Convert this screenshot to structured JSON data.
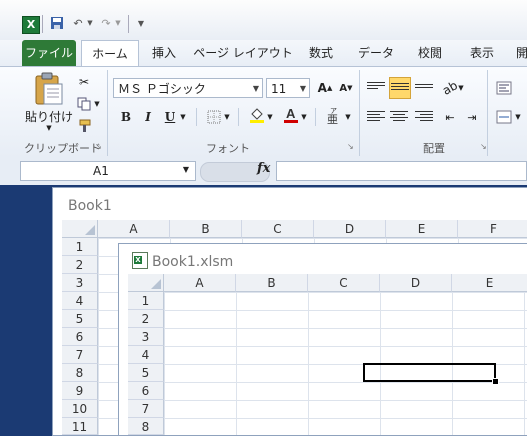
{
  "colors": {
    "file_tab": "#2e7a37",
    "frame": "#1b3a73"
  },
  "tabs": [
    "ファイル",
    "ホーム",
    "挿入",
    "ページ レイアウト",
    "数式",
    "データ",
    "校閲",
    "表示",
    "開"
  ],
  "clipboard": {
    "paste_label": "貼り付け",
    "group_label": "クリップボード"
  },
  "font": {
    "name": "ＭＳ Ｐゴシック",
    "size": "11",
    "group_label": "フォント"
  },
  "alignment": {
    "group_label": "配置"
  },
  "formula_bar": {
    "name_box": "A1",
    "fx": "fx",
    "formula": ""
  },
  "book1": {
    "title": "Book1",
    "columns": [
      "A",
      "B",
      "C",
      "D",
      "E",
      "F"
    ],
    "rows": [
      "1",
      "2",
      "3",
      "4",
      "5",
      "6",
      "7",
      "8",
      "9",
      "10",
      "11"
    ]
  },
  "book1xlsm": {
    "title": "Book1.xlsm",
    "columns": [
      "A",
      "B",
      "C",
      "D",
      "E"
    ],
    "rows": [
      "1",
      "2",
      "3",
      "4",
      "5",
      "6",
      "7",
      "8"
    ]
  }
}
